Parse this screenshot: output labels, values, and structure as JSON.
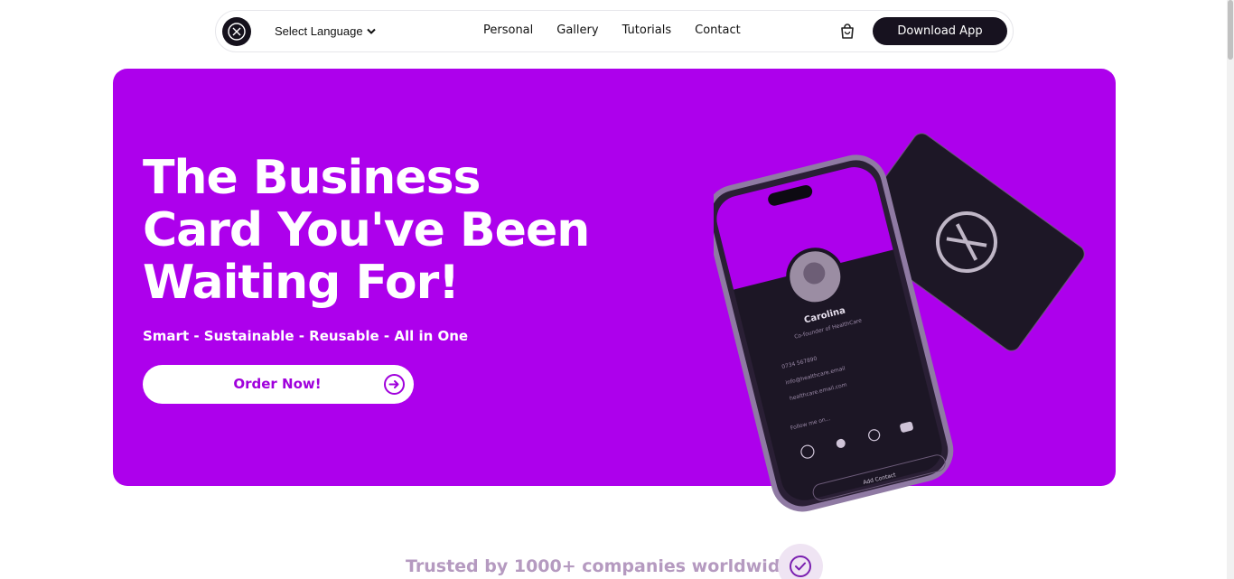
{
  "nav": {
    "language_label": "Select Language",
    "links": [
      "Personal",
      "Gallery",
      "Tutorials",
      "Contact"
    ],
    "download_label": "Download App",
    "icons": [
      "logo-x-icon",
      "chevron-down-icon",
      "shopping-bag-icon"
    ]
  },
  "hero": {
    "title_lines": [
      "The Business",
      "Card You've Been",
      "Waiting For!"
    ],
    "subtitle": "Smart - Sustainable - Reusable - All in One",
    "cta_label": "Order Now!",
    "background_color": "#ad00ec",
    "phone": {
      "name": "Carolina",
      "role": "Co-founder of HealthCare",
      "phone": "0734 567890",
      "email": "info@healthcare.email",
      "website": "healthcare.email.com",
      "follow_label": "Follow me on...",
      "socials": [
        "Instagram",
        "TikTok",
        "WhatsApp",
        "YouTube"
      ],
      "add_contact": "Add Contact"
    }
  },
  "trusted": {
    "text": "Trusted by 1000+ companies worldwide",
    "icon": "check-circle-icon"
  }
}
